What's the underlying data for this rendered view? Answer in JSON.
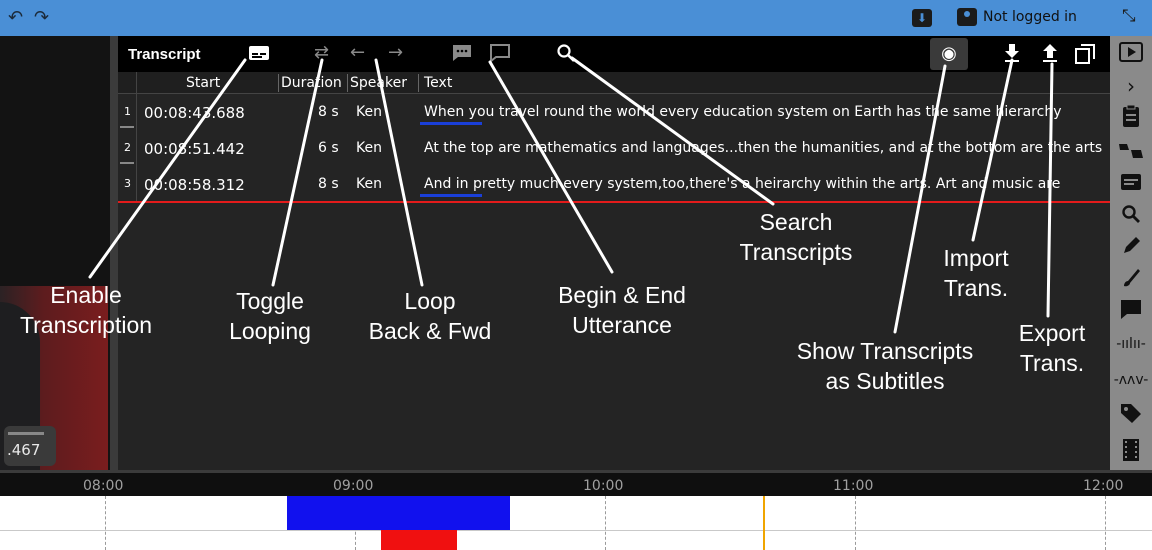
{
  "topbar": {
    "login_text": "Not logged in",
    "icons": [
      "undo-icon",
      "redo-icon",
      "download-icon",
      "user-icon",
      "collapse-icon"
    ]
  },
  "video": {
    "time_label": ".467"
  },
  "transcript": {
    "title": "Transcript",
    "columns": {
      "start": "Start",
      "duration": "Duration",
      "speaker": "Speaker",
      "text": "Text"
    },
    "rows": [
      {
        "num": "1",
        "start": "00:08:43.688",
        "duration": "8 s",
        "speaker": "Ken",
        "text": "When you travel round the world every education system on Earth has the same hierarchy"
      },
      {
        "num": "2",
        "start": "00:08:51.442",
        "duration": "6 s",
        "speaker": "Ken",
        "text": "At the top are mathematics and languages...then the humanities, and at the bottom are the arts"
      },
      {
        "num": "3",
        "start": "00:08:58.312",
        "duration": "8 s",
        "speaker": "Ken",
        "text": "And in pretty much every system,too,there's a heirarchy within the arts. Art and music are"
      }
    ]
  },
  "timeline": {
    "ticks": [
      "08:00",
      "09:00",
      "10:00",
      "11:00",
      "12:00"
    ]
  },
  "annotations": {
    "enable_transcription": "Enable\nTranscription",
    "toggle_looping": "Toggle\nLooping",
    "loop_back_fwd": "Loop\nBack & Fwd",
    "begin_end_utterance": "Begin & End\nUtterance",
    "search_transcripts": "Search\nTranscripts",
    "show_subtitles": "Show Transcripts\nas Subtitles",
    "import_trans": "Import\nTrans.",
    "export_trans": "Export\nTrans."
  },
  "colors": {
    "topbar": "#4a8fd6",
    "panel_bg": "#242424",
    "cursor_line": "#e31b1b",
    "utterance_underline": "#1a3fd8",
    "timeline_blue": "#1111ee",
    "timeline_red": "#f01010",
    "playhead": "#f0a500"
  }
}
